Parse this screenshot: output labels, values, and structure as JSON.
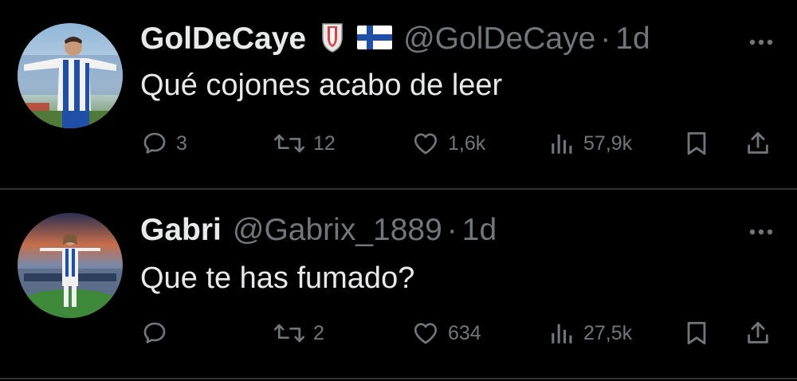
{
  "tweets": [
    {
      "name": "GolDeCaye",
      "handle": "@GolDeCaye",
      "separator": "·",
      "time": "1d",
      "text": "Qué cojones acabo de leer",
      "replies": "3",
      "retweets": "12",
      "likes": "1,6k",
      "views": "57,9k",
      "badges": [
        "club-crest-icon",
        "finland-flag-icon"
      ]
    },
    {
      "name": "Gabri",
      "handle": "@Gabrix_1889",
      "separator": "·",
      "time": "1d",
      "text": "Que te has fumado?",
      "replies": "",
      "retweets": "2",
      "likes": "634",
      "views": "27,5k",
      "badges": []
    }
  ],
  "colors": {
    "background": "#000000",
    "primary_text": "#e7e9ea",
    "secondary_text": "#71767b",
    "divider": "#2f3336"
  }
}
